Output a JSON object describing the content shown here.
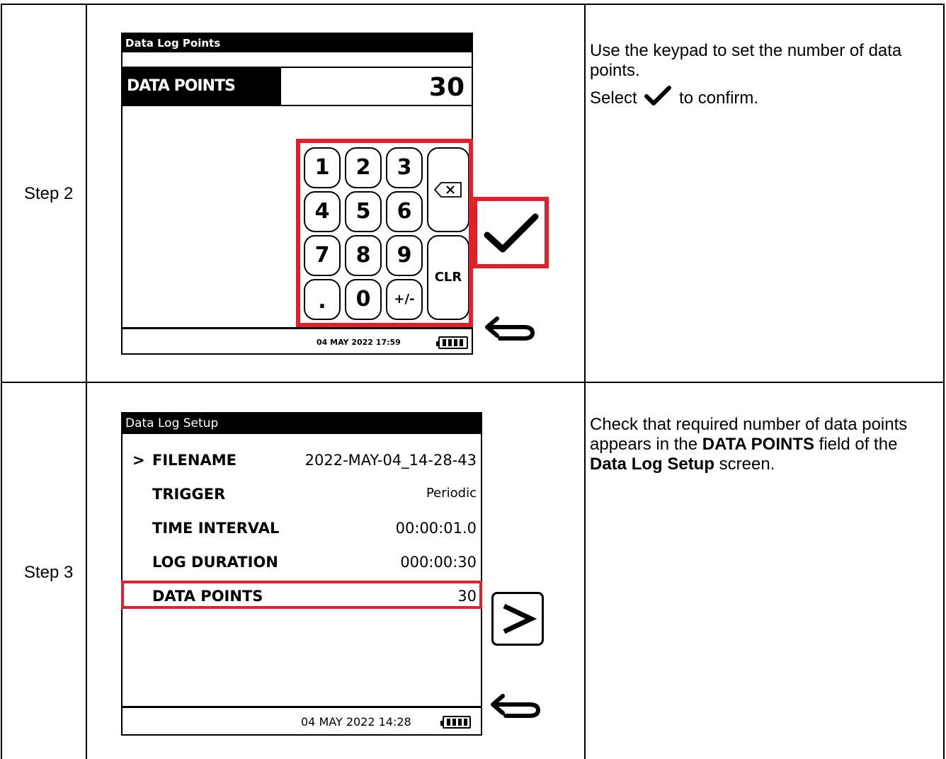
{
  "rows": [
    {
      "step": "Step 2",
      "instructions": {
        "line1": "Use the keypad to set the number of data points.",
        "select_word": "Select",
        "confirm_suffix": "to confirm."
      },
      "screen": {
        "title": "Data Log  Points",
        "field_label": "DATA POINTS",
        "field_value": "30",
        "keys": [
          "1",
          "2",
          "3",
          "4",
          "5",
          "6",
          "7",
          "8",
          "9",
          ".",
          "0",
          "+/-"
        ],
        "clear_key": "CLR",
        "status_date": "04 MAY 2022 17:59"
      }
    },
    {
      "step": "Step 3",
      "instructions": {
        "part1": "Check that required number of data points appears in the ",
        "bold1": "DATA POINTS",
        "part2": " field of the ",
        "bold2": "Data Log Setup",
        "part3": " screen."
      },
      "screen": {
        "title": "Data Log Setup",
        "rows": [
          {
            "label": "FILENAME",
            "value": "2022-MAY-04_14-28-43"
          },
          {
            "label": "TRIGGER",
            "value": "Periodic"
          },
          {
            "label": "TIME INTERVAL",
            "value": "00:00:01.0"
          },
          {
            "label": "LOG DURATION",
            "value": "000:00:30"
          },
          {
            "label": "DATA POINTS",
            "value": "30"
          }
        ],
        "status_date": "04 MAY 2022 14:28"
      }
    }
  ],
  "icons": {
    "confirm": "checkmark-icon",
    "back": "back-arrow-icon",
    "backspace": "backspace-icon",
    "next": "chevron-right-icon",
    "battery": "battery-icon"
  },
  "colors": {
    "highlight": "#e0202a"
  }
}
